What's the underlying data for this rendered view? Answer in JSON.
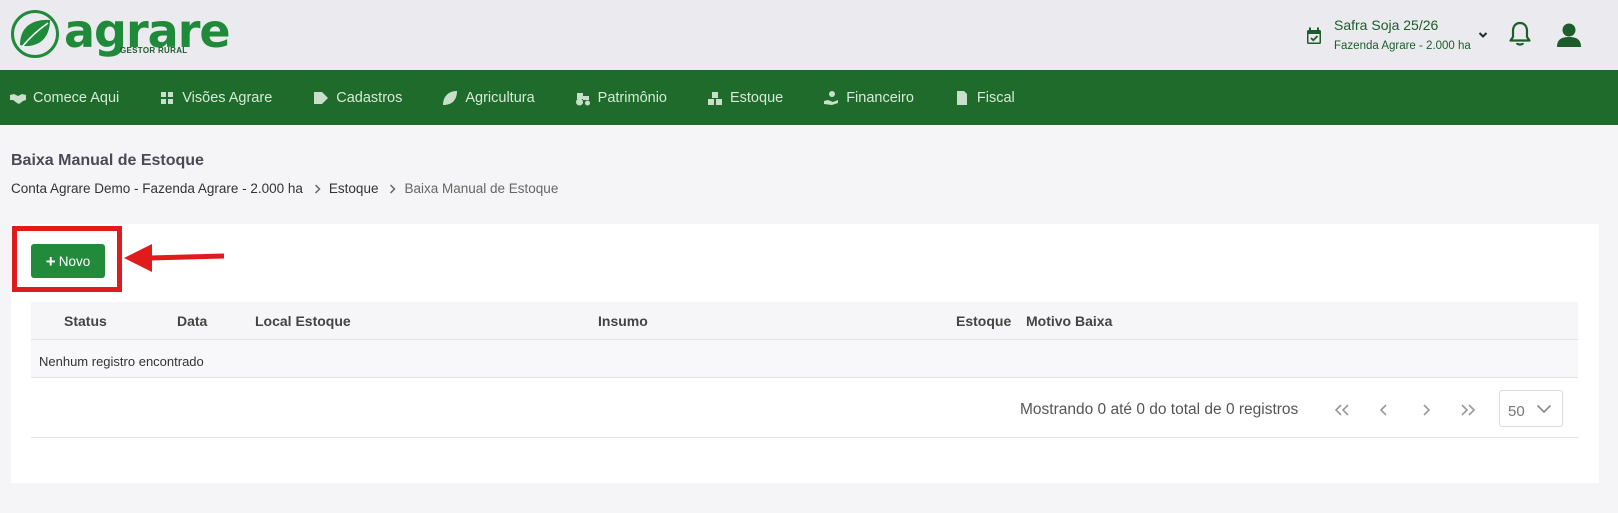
{
  "brand": {
    "name": "agrare",
    "subtitle": "GESTOR RURAL",
    "color": "#1f8a3a"
  },
  "header": {
    "safra_title": "Safra Soja 25/26",
    "safra_subtitle": "Fazenda Agrare - 2.000 ha"
  },
  "nav": {
    "items": [
      {
        "label": "Comece Aqui",
        "icon": "handshake-icon"
      },
      {
        "label": "Visões Agrare",
        "icon": "grid-icon"
      },
      {
        "label": "Cadastros",
        "icon": "tag-icon"
      },
      {
        "label": "Agricultura",
        "icon": "leaf-icon"
      },
      {
        "label": "Patrimônio",
        "icon": "tractor-icon"
      },
      {
        "label": "Estoque",
        "icon": "boxes-icon"
      },
      {
        "label": "Financeiro",
        "icon": "hand-money-icon"
      },
      {
        "label": "Fiscal",
        "icon": "invoice-icon"
      }
    ],
    "background": "#1e6b2b"
  },
  "page": {
    "title": "Baixa Manual de Estoque",
    "breadcrumb": [
      "Conta Agrare Demo - Fazenda Agrare - 2.000 ha",
      "Estoque",
      "Baixa Manual de Estoque"
    ]
  },
  "toolbar": {
    "new_label": "Novo",
    "new_color": "#218b3b"
  },
  "annotation": {
    "color": "#e01b1b"
  },
  "table": {
    "columns": [
      "Status",
      "Data",
      "Local Estoque",
      "Insumo",
      "Estoque",
      "Motivo Baixa"
    ],
    "empty_message": "Nenhum registro encontrado"
  },
  "pagination": {
    "summary": "Mostrando 0 até 0 do total de 0 registros",
    "page_size": "50"
  }
}
